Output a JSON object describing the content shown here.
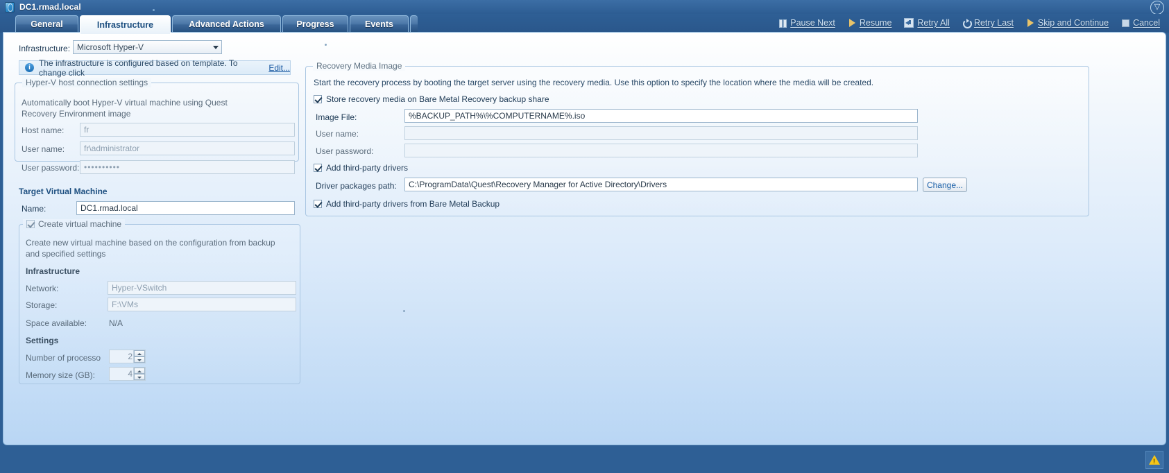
{
  "window": {
    "title": "DC1.rmad.local",
    "icon": "server-globe-icon",
    "collapse_icon": "chevron-down-circle-icon"
  },
  "tabs": [
    {
      "label": "General",
      "active": false
    },
    {
      "label": "Infrastructure",
      "active": true
    },
    {
      "label": "Advanced Actions",
      "active": false
    },
    {
      "label": "Progress",
      "active": false
    },
    {
      "label": "Events",
      "active": false
    }
  ],
  "toolbar": [
    {
      "label": "Pause Next",
      "icon": "pause-icon"
    },
    {
      "label": "Resume",
      "icon": "play-icon"
    },
    {
      "label": "Retry All",
      "icon": "retry-all-icon"
    },
    {
      "label": "Retry Last",
      "icon": "retry-last-icon"
    },
    {
      "label": "Skip and Continue",
      "icon": "play-icon"
    },
    {
      "label": "Cancel",
      "icon": "stop-icon"
    }
  ],
  "left": {
    "infrastructure_label": "Infrastructure:",
    "infrastructure_value": "Microsoft Hyper-V",
    "info_text": "The infrastructure is configured based on template. To change click",
    "info_link": "Edit...",
    "host_group_title": "Hyper-V host connection settings",
    "host_group_desc": "Automatically boot Hyper-V virtual machine using Quest Recovery Environment image",
    "host_name_label": "Host name:",
    "host_name_value": "fr",
    "host_user_label": "User name:",
    "host_user_value": "fr\\administrator",
    "host_pass_label": "User password:",
    "host_pass_value": "••••••••••",
    "target_vm_heading": "Target Virtual Machine",
    "vm_name_label": "Name:",
    "vm_name_value": "DC1.rmad.local",
    "create_vm_label": "Create virtual machine",
    "create_vm_checked": true,
    "create_vm_desc": "Create new virtual machine based on the configuration from backup and specified settings",
    "infra_sub_heading": "Infrastructure",
    "network_label": "Network:",
    "network_value": "Hyper-VSwitch",
    "storage_label": "Storage:",
    "storage_value": "F:\\VMs",
    "space_label": "Space available:",
    "space_value": "N/A",
    "settings_heading": "Settings",
    "cpu_label": "Number of processo",
    "cpu_value": "2",
    "mem_label": "Memory size (GB):",
    "mem_value": "4"
  },
  "right": {
    "group_title": "Recovery Media Image",
    "description": "Start the recovery process by booting the target server using the recovery media. Use this option to specify the location where the media will be created.",
    "store_media_label": "Store recovery media on Bare Metal Recovery backup share",
    "store_media_checked": true,
    "image_file_label": "Image File:",
    "image_file_value": "%BACKUP_PATH%\\%COMPUTERNAME%.iso",
    "user_name_label": "User name:",
    "user_name_value": "",
    "user_password_label": "User password:",
    "user_password_value": "",
    "add_drivers_label": "Add third-party drivers",
    "add_drivers_checked": true,
    "driver_path_label": "Driver packages path:",
    "driver_path_value": "C:\\ProgramData\\Quest\\Recovery Manager for Active Directory\\Drivers",
    "change_button": "Change...",
    "add_bmr_drivers_label": "Add third-party drivers from Bare Metal Backup",
    "add_bmr_drivers_checked": true
  },
  "statusbar": {
    "warning_icon": "warning-triangle-icon"
  },
  "colors": {
    "chrome": "#2e5f95",
    "accent": "#1757a0",
    "panel": "#dbeafa",
    "warning": "#f5c518"
  }
}
